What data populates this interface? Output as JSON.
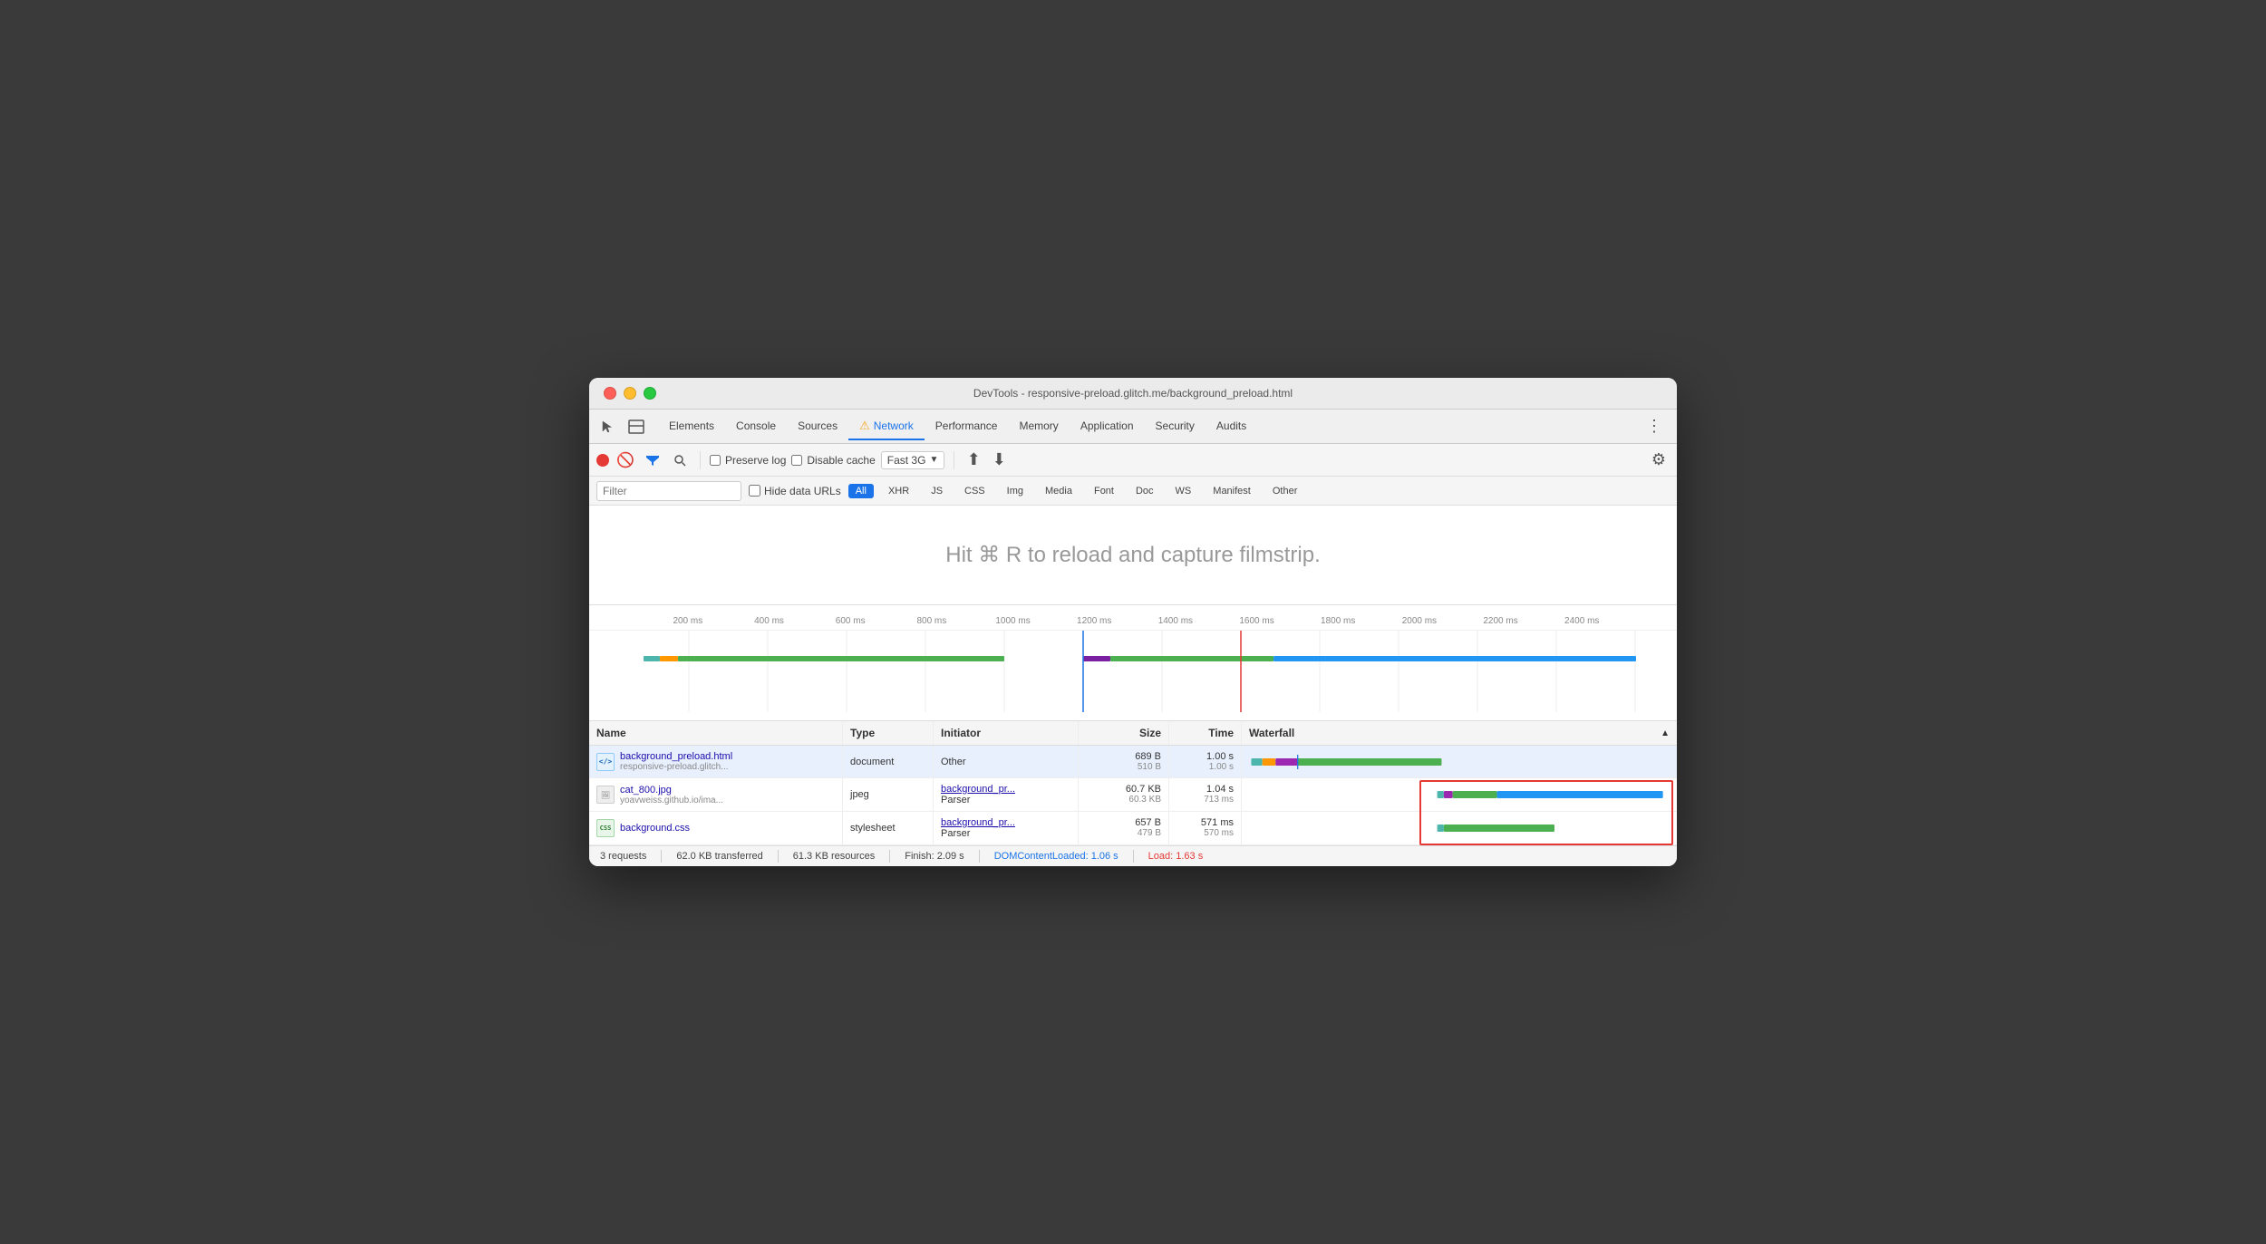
{
  "window": {
    "title": "DevTools - responsive-preload.glitch.me/background_preload.html"
  },
  "tabs": {
    "items": [
      {
        "label": "Elements",
        "active": false
      },
      {
        "label": "Console",
        "active": false
      },
      {
        "label": "Sources",
        "active": false
      },
      {
        "label": "Network",
        "active": true,
        "warning": true
      },
      {
        "label": "Performance",
        "active": false
      },
      {
        "label": "Memory",
        "active": false
      },
      {
        "label": "Application",
        "active": false
      },
      {
        "label": "Security",
        "active": false
      },
      {
        "label": "Audits",
        "active": false
      }
    ]
  },
  "toolbar": {
    "preserve_log": "Preserve log",
    "disable_cache": "Disable cache",
    "throttle": "Fast 3G",
    "settings_tooltip": "Settings"
  },
  "filter": {
    "placeholder": "Filter",
    "hide_data_urls": "Hide data URLs",
    "buttons": [
      "All",
      "XHR",
      "JS",
      "CSS",
      "Img",
      "Media",
      "Font",
      "Doc",
      "WS",
      "Manifest",
      "Other"
    ]
  },
  "filmstrip": {
    "message": "Hit ⌘ R to reload and capture filmstrip."
  },
  "timeline": {
    "ticks": [
      "200 ms",
      "400 ms",
      "600 ms",
      "800 ms",
      "1000 ms",
      "1200 ms",
      "1400 ms",
      "1600 ms",
      "1800 ms",
      "2000 ms",
      "2200 ms",
      "2400 ms"
    ]
  },
  "table": {
    "headers": [
      "Name",
      "Type",
      "Initiator",
      "Size",
      "Time",
      "Waterfall"
    ],
    "rows": [
      {
        "filename": "background_preload.html",
        "domain": "responsive-preload.glitch...",
        "type": "document",
        "initiator": "Other",
        "initiator_link": false,
        "size_primary": "689 B",
        "size_secondary": "510 B",
        "time_primary": "1.00 s",
        "time_secondary": "1.00 s",
        "icon": "html",
        "selected": true
      },
      {
        "filename": "cat_800.jpg",
        "domain": "yoavweiss.github.io/ima...",
        "type": "jpeg",
        "initiator": "background_pr...",
        "initiator2": "Parser",
        "initiator_link": true,
        "size_primary": "60.7 KB",
        "size_secondary": "60.3 KB",
        "time_primary": "1.04 s",
        "time_secondary": "713 ms",
        "icon": "img",
        "selected": false
      },
      {
        "filename": "background.css",
        "domain": "",
        "type": "stylesheet",
        "initiator": "background_pr...",
        "initiator2": "Parser",
        "initiator_link": true,
        "size_primary": "657 B",
        "size_secondary": "479 B",
        "time_primary": "571 ms",
        "time_secondary": "570 ms",
        "icon": "css",
        "selected": false
      }
    ]
  },
  "status_bar": {
    "requests": "3 requests",
    "transferred": "62.0 KB transferred",
    "resources": "61.3 KB resources",
    "finish": "Finish: 2.09 s",
    "dom_content_loaded": "DOMContentLoaded: 1.06 s",
    "load": "Load: 1.63 s"
  }
}
